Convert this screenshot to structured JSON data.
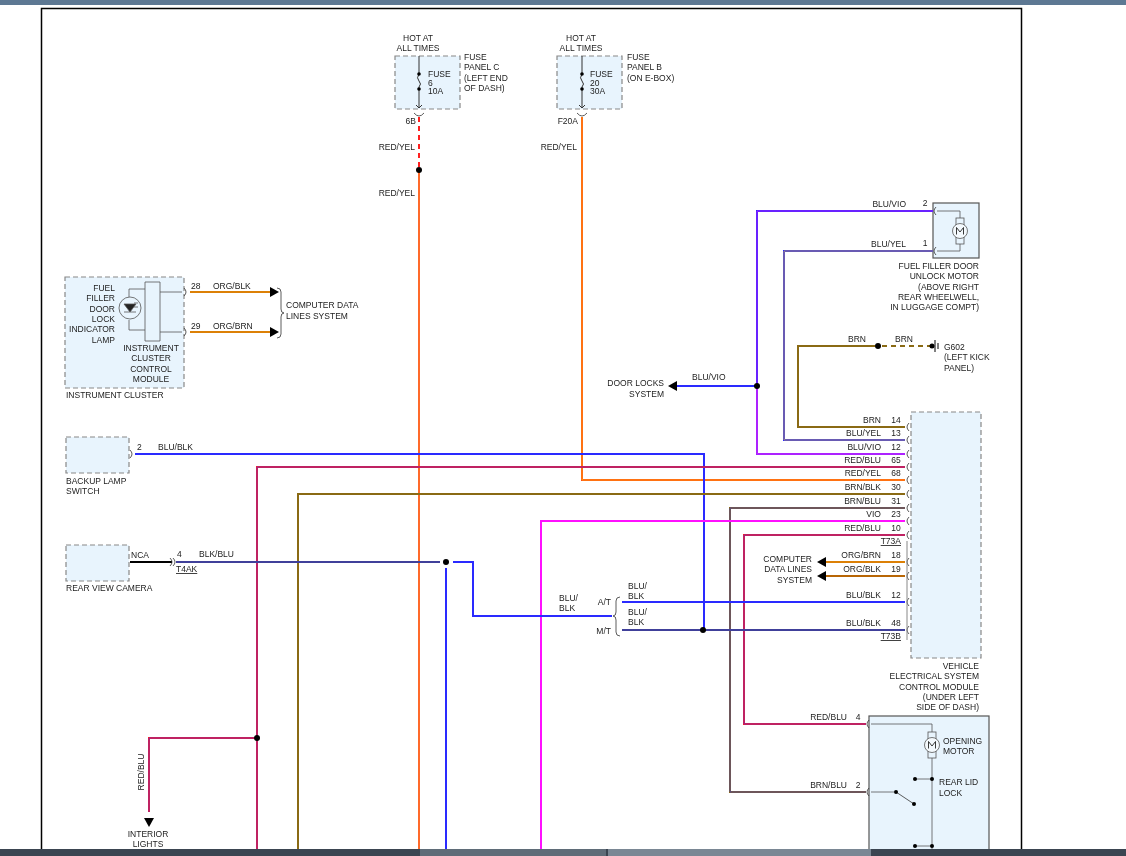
{
  "diagram": {
    "texts": [
      {
        "kind": "component",
        "lines": [
          "HOT AT",
          "ALL TIMES"
        ]
      },
      {
        "kind": "component",
        "lines": [
          "FUSE",
          "PANEL C",
          "(LEFT END",
          "OF DASH)"
        ]
      },
      {
        "kind": "fuse",
        "lines": [
          "FUSE",
          "6",
          "10A"
        ]
      },
      {
        "kind": "pin",
        "lines": [
          "6B"
        ]
      },
      {
        "kind": "wire",
        "lines": [
          "RED/YEL"
        ]
      },
      {
        "kind": "wire",
        "lines": [
          "RED/YEL"
        ]
      },
      {
        "kind": "component",
        "lines": [
          "HOT AT",
          "ALL TIMES"
        ]
      },
      {
        "kind": "component",
        "lines": [
          "FUSE",
          "PANEL B",
          "(ON E-BOX)"
        ]
      },
      {
        "kind": "fuse",
        "lines": [
          "FUSE",
          "20",
          "30A"
        ]
      },
      {
        "kind": "pin",
        "lines": [
          "F20A"
        ]
      },
      {
        "kind": "wire",
        "lines": [
          "RED/YEL"
        ]
      },
      {
        "kind": "wire",
        "lines": [
          "BLU/VIO"
        ]
      },
      {
        "kind": "pin",
        "lines": [
          "2"
        ]
      },
      {
        "kind": "wire",
        "lines": [
          "BLU/YEL"
        ]
      },
      {
        "kind": "pin",
        "lines": [
          "1"
        ]
      },
      {
        "kind": "component",
        "lines": [
          "FUEL FILLER DOOR",
          "UNLOCK MOTOR",
          "(ABOVE RIGHT",
          "REAR WHEELWELL,",
          "IN LUGGAGE COMPT)"
        ]
      },
      {
        "kind": "wire",
        "lines": [
          "BRN"
        ]
      },
      {
        "kind": "wire",
        "lines": [
          "BRN"
        ]
      },
      {
        "kind": "component",
        "lines": [
          "G602",
          "(LEFT KICK",
          "PANEL)"
        ]
      },
      {
        "kind": "destination",
        "lines": [
          "DOOR LOCKS",
          "SYSTEM"
        ]
      },
      {
        "kind": "wire",
        "lines": [
          "BLU/VIO"
        ]
      },
      {
        "kind": "component",
        "lines": [
          "FUEL",
          "FILLER",
          "DOOR",
          "LOCK",
          "INDICATOR",
          "LAMP"
        ]
      },
      {
        "kind": "component",
        "lines": [
          "INSTRUMENT",
          "CLUSTER",
          "CONTROL",
          "MODULE"
        ]
      },
      {
        "kind": "component",
        "lines": [
          "INSTRUMENT CLUSTER"
        ]
      },
      {
        "kind": "pin",
        "lines": [
          "28"
        ]
      },
      {
        "kind": "wire",
        "lines": [
          "ORG/BLK"
        ]
      },
      {
        "kind": "pin",
        "lines": [
          "29"
        ]
      },
      {
        "kind": "wire",
        "lines": [
          "ORG/BRN"
        ]
      },
      {
        "kind": "destination",
        "lines": [
          "COMPUTER DATA",
          "LINES SYSTEM"
        ]
      },
      {
        "kind": "pin",
        "lines": [
          "2"
        ]
      },
      {
        "kind": "wire",
        "lines": [
          "BLU/BLK"
        ]
      },
      {
        "kind": "component",
        "lines": [
          "BACKUP LAMP",
          "SWITCH"
        ]
      },
      {
        "kind": "note",
        "lines": [
          "NCA"
        ]
      },
      {
        "kind": "pin",
        "lines": [
          "4"
        ]
      },
      {
        "kind": "wire",
        "lines": [
          "BLK/BLU"
        ]
      },
      {
        "kind": "connector",
        "lines": [
          "T4AK"
        ]
      },
      {
        "kind": "component",
        "lines": [
          "REAR VIEW CAMERA"
        ]
      },
      {
        "kind": "wire",
        "lines": [
          "RED/BLU"
        ]
      },
      {
        "kind": "destination",
        "lines": [
          "INTERIOR",
          "LIGHTS"
        ]
      },
      {
        "kind": "wire",
        "lines": [
          "BLU/",
          "BLK"
        ]
      },
      {
        "kind": "note",
        "lines": [
          "A/T"
        ]
      },
      {
        "kind": "note",
        "lines": [
          "M/T"
        ]
      },
      {
        "kind": "wire",
        "lines": [
          "BLU/",
          "BLK"
        ]
      },
      {
        "kind": "wire",
        "lines": [
          "BLU/",
          "BLK"
        ]
      },
      {
        "kind": "wire",
        "lines": [
          "BRN"
        ]
      },
      {
        "kind": "pin",
        "lines": [
          "14"
        ]
      },
      {
        "kind": "wire",
        "lines": [
          "BLU/YEL"
        ]
      },
      {
        "kind": "pin",
        "lines": [
          "13"
        ]
      },
      {
        "kind": "wire",
        "lines": [
          "BLU/VIO"
        ]
      },
      {
        "kind": "pin",
        "lines": [
          "12"
        ]
      },
      {
        "kind": "wire",
        "lines": [
          "RED/BLU"
        ]
      },
      {
        "kind": "pin",
        "lines": [
          "65"
        ]
      },
      {
        "kind": "wire",
        "lines": [
          "RED/YEL"
        ]
      },
      {
        "kind": "pin",
        "lines": [
          "68"
        ]
      },
      {
        "kind": "wire",
        "lines": [
          "BRN/BLK"
        ]
      },
      {
        "kind": "pin",
        "lines": [
          "30"
        ]
      },
      {
        "kind": "wire",
        "lines": [
          "BRN/BLU"
        ]
      },
      {
        "kind": "pin",
        "lines": [
          "31"
        ]
      },
      {
        "kind": "wire",
        "lines": [
          "VIO"
        ]
      },
      {
        "kind": "pin",
        "lines": [
          "23"
        ]
      },
      {
        "kind": "wire",
        "lines": [
          "RED/BLU"
        ]
      },
      {
        "kind": "pin",
        "lines": [
          "10"
        ]
      },
      {
        "kind": "connector",
        "lines": [
          "T73A"
        ]
      },
      {
        "kind": "wire",
        "lines": [
          "ORG/BRN"
        ]
      },
      {
        "kind": "pin",
        "lines": [
          "18"
        ]
      },
      {
        "kind": "wire",
        "lines": [
          "ORG/BLK"
        ]
      },
      {
        "kind": "pin",
        "lines": [
          "19"
        ]
      },
      {
        "kind": "destination",
        "lines": [
          "COMPUTER",
          "DATA LINES",
          "SYSTEM"
        ]
      },
      {
        "kind": "wire",
        "lines": [
          "BLU/BLK"
        ]
      },
      {
        "kind": "pin",
        "lines": [
          "12"
        ]
      },
      {
        "kind": "wire",
        "lines": [
          "BLU/BLK"
        ]
      },
      {
        "kind": "pin",
        "lines": [
          "48"
        ]
      },
      {
        "kind": "connector",
        "lines": [
          "T73B"
        ]
      },
      {
        "kind": "component",
        "lines": [
          "VEHICLE",
          "ELECTRICAL SYSTEM",
          "CONTROL MODULE",
          "(UNDER LEFT",
          "SIDE OF DASH)"
        ]
      },
      {
        "kind": "wire",
        "lines": [
          "RED/BLU"
        ]
      },
      {
        "kind": "pin",
        "lines": [
          "4"
        ]
      },
      {
        "kind": "wire",
        "lines": [
          "BRN/BLU"
        ]
      },
      {
        "kind": "pin",
        "lines": [
          "2"
        ]
      },
      {
        "kind": "component",
        "lines": [
          "OPENING",
          "MOTOR"
        ]
      },
      {
        "kind": "component",
        "lines": [
          "REAR LID",
          "LOCK"
        ]
      }
    ]
  }
}
